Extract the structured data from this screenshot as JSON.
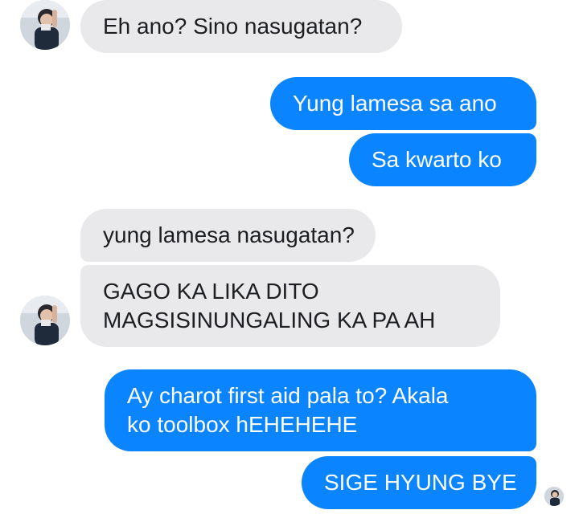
{
  "messages": [
    {
      "sender": "contact",
      "text": "Eh ano? Sino nasugatan?"
    },
    {
      "sender": "self",
      "text": "Yung lamesa sa ano"
    },
    {
      "sender": "self",
      "text": "Sa kwarto ko"
    },
    {
      "sender": "contact",
      "text": "yung lamesa nasugatan?"
    },
    {
      "sender": "contact",
      "text": "GAGO KA LIKA DITO MAGSISINUNGALING KA PA AH",
      "lines": [
        "GAGO KA LIKA DITO",
        "MAGSISINUNGALING KA PA AH"
      ]
    },
    {
      "sender": "self",
      "text": "Ay charot first aid pala to? Akala ko toolbox hEHEHEHE",
      "lines": [
        "Ay charot first aid pala to? Akala",
        "ko toolbox hEHEHEHE"
      ]
    },
    {
      "sender": "self",
      "text": "SIGE HYUNG BYE"
    }
  ],
  "colors": {
    "outgoing_bubble": "#0a84ff",
    "incoming_bubble": "#e9e9eb",
    "background": "#ffffff"
  },
  "icons": {
    "contact_avatar": "contact-avatar-icon",
    "seen_indicator": "read-receipt-avatar-icon"
  }
}
